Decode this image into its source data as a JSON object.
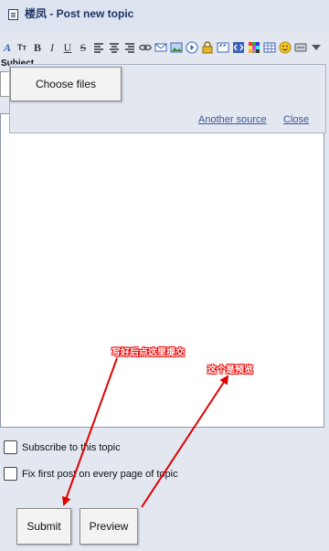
{
  "header": {
    "title": "楼凤 - Post new topic"
  },
  "form": {
    "subject_label": "Subject"
  },
  "attachment": {
    "choose_files_label": "Choose files",
    "another_source_label": "Another source",
    "close_label": "Close"
  },
  "options": {
    "subscribe_label": "Subscribe to this topic",
    "fix_first_post_label": "Fix first post on every page of topic"
  },
  "buttons": {
    "submit_label": "Submit",
    "preview_label": "Preview"
  },
  "annotations": {
    "submit_hint": "写好后点这里提交",
    "preview_hint": "这个是预览"
  },
  "colors": {
    "background": "#e3e7f0",
    "title": "#1e3464",
    "link": "#3a5a97",
    "annotation": "#e00000"
  },
  "toolbar_icons": [
    "font-icon",
    "text-size-icon",
    "bold-icon",
    "italic-icon",
    "underline-icon",
    "strikethrough-icon",
    "align-left-icon",
    "align-center-icon",
    "align-right-icon",
    "link-icon",
    "email-icon",
    "image-icon",
    "video-icon",
    "lock-icon",
    "quote-icon",
    "code-icon",
    "color-icon",
    "table-icon",
    "smiley-icon",
    "spoiler-icon",
    "more-icon"
  ]
}
